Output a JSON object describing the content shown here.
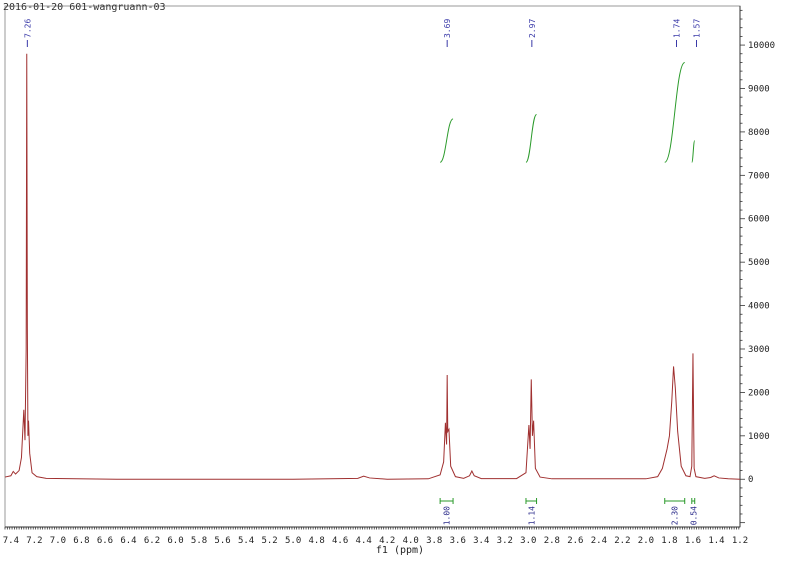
{
  "header": {
    "title": "2016-01-20 601-wangruann-03"
  },
  "chart_data": {
    "type": "line",
    "title": "2016-01-20 601-wangruann-03",
    "xlabel": "f1 (ppm)",
    "ylabel": "",
    "xlim": [
      7.45,
      1.2
    ],
    "ylim": [
      -1100,
      10900
    ],
    "x_reversed": true,
    "x_ticks": [
      "7.4",
      "7.2",
      "7.0",
      "6.8",
      "6.6",
      "6.4",
      "6.2",
      "6.0",
      "5.8",
      "5.6",
      "5.4",
      "5.2",
      "5.0",
      "4.8",
      "4.6",
      "4.4",
      "4.2",
      "4.0",
      "3.8",
      "3.6",
      "3.4",
      "3.2",
      "3.0",
      "2.8",
      "2.6",
      "2.4",
      "2.2",
      "2.0",
      "1.8",
      "1.6",
      "1.4",
      "1.2"
    ],
    "y_ticks": [
      "10000",
      "9000",
      "8000",
      "7000",
      "6000",
      "5000",
      "4000",
      "3000",
      "2000",
      "1000",
      "0"
    ],
    "y_axis_position": "right",
    "grid": false,
    "series": [
      {
        "points": [
          [
            7.45,
            50
          ],
          [
            7.4,
            80
          ],
          [
            7.38,
            180
          ],
          [
            7.36,
            120
          ],
          [
            7.33,
            200
          ],
          [
            7.31,
            500
          ],
          [
            7.29,
            1600
          ],
          [
            7.28,
            900
          ],
          [
            7.27,
            3000
          ],
          [
            7.265,
            9800
          ],
          [
            7.26,
            3500
          ],
          [
            7.255,
            1000
          ],
          [
            7.25,
            1350
          ],
          [
            7.24,
            600
          ],
          [
            7.22,
            150
          ],
          [
            7.18,
            60
          ],
          [
            7.1,
            20
          ],
          [
            6.5,
            0
          ],
          [
            5.0,
            0
          ],
          [
            4.45,
            20
          ],
          [
            4.4,
            70
          ],
          [
            4.35,
            30
          ],
          [
            4.2,
            0
          ],
          [
            3.85,
            10
          ],
          [
            3.75,
            100
          ],
          [
            3.72,
            400
          ],
          [
            3.705,
            1300
          ],
          [
            3.695,
            800
          ],
          [
            3.69,
            2400
          ],
          [
            3.685,
            1100
          ],
          [
            3.675,
            1150
          ],
          [
            3.66,
            300
          ],
          [
            3.62,
            60
          ],
          [
            3.55,
            20
          ],
          [
            3.5,
            80
          ],
          [
            3.48,
            190
          ],
          [
            3.46,
            80
          ],
          [
            3.4,
            15
          ],
          [
            3.1,
            15
          ],
          [
            3.02,
            150
          ],
          [
            2.995,
            1250
          ],
          [
            2.985,
            700
          ],
          [
            2.975,
            2300
          ],
          [
            2.965,
            1000
          ],
          [
            2.955,
            1350
          ],
          [
            2.94,
            250
          ],
          [
            2.9,
            50
          ],
          [
            2.8,
            10
          ],
          [
            2.0,
            10
          ],
          [
            1.9,
            60
          ],
          [
            1.86,
            250
          ],
          [
            1.82,
            700
          ],
          [
            1.8,
            1000
          ],
          [
            1.78,
            1800
          ],
          [
            1.765,
            2600
          ],
          [
            1.75,
            2100
          ],
          [
            1.73,
            1100
          ],
          [
            1.7,
            300
          ],
          [
            1.66,
            80
          ],
          [
            1.625,
            60
          ],
          [
            1.61,
            300
          ],
          [
            1.6,
            2900
          ],
          [
            1.59,
            250
          ],
          [
            1.575,
            60
          ],
          [
            1.5,
            20
          ],
          [
            1.45,
            40
          ],
          [
            1.42,
            80
          ],
          [
            1.38,
            30
          ],
          [
            1.3,
            10
          ],
          [
            1.2,
            0
          ]
        ]
      }
    ],
    "peak_labels": [
      {
        "ppm": 7.26,
        "text": "7.26"
      },
      {
        "ppm": 3.69,
        "text": "3.69"
      },
      {
        "ppm": 2.97,
        "text": "2.97"
      },
      {
        "ppm": 1.74,
        "text": "1.74"
      },
      {
        "ppm": 1.57,
        "text": "1.57"
      }
    ],
    "integrals": [
      {
        "from": 3.75,
        "to": 3.64,
        "value": "1.00",
        "curve_bottom": 7300,
        "curve_top": 8300
      },
      {
        "from": 3.02,
        "to": 2.93,
        "value": "1.14",
        "curve_bottom": 7300,
        "curve_top": 8400
      },
      {
        "from": 1.84,
        "to": 1.67,
        "value": "2.30",
        "curve_bottom": 7300,
        "curve_top": 9600
      },
      {
        "from": 1.61,
        "to": 1.585,
        "value": "0.54",
        "curve_bottom": 7300,
        "curve_top": 7800
      }
    ],
    "colors": {
      "spectrum": "#a03030",
      "peak_marker": "#3a3aa8",
      "integral_curve": "#2a9a2a",
      "integral_bracket": "#2a9a2a",
      "integral_value": "#2a2a8a",
      "axis": "#333333"
    }
  }
}
